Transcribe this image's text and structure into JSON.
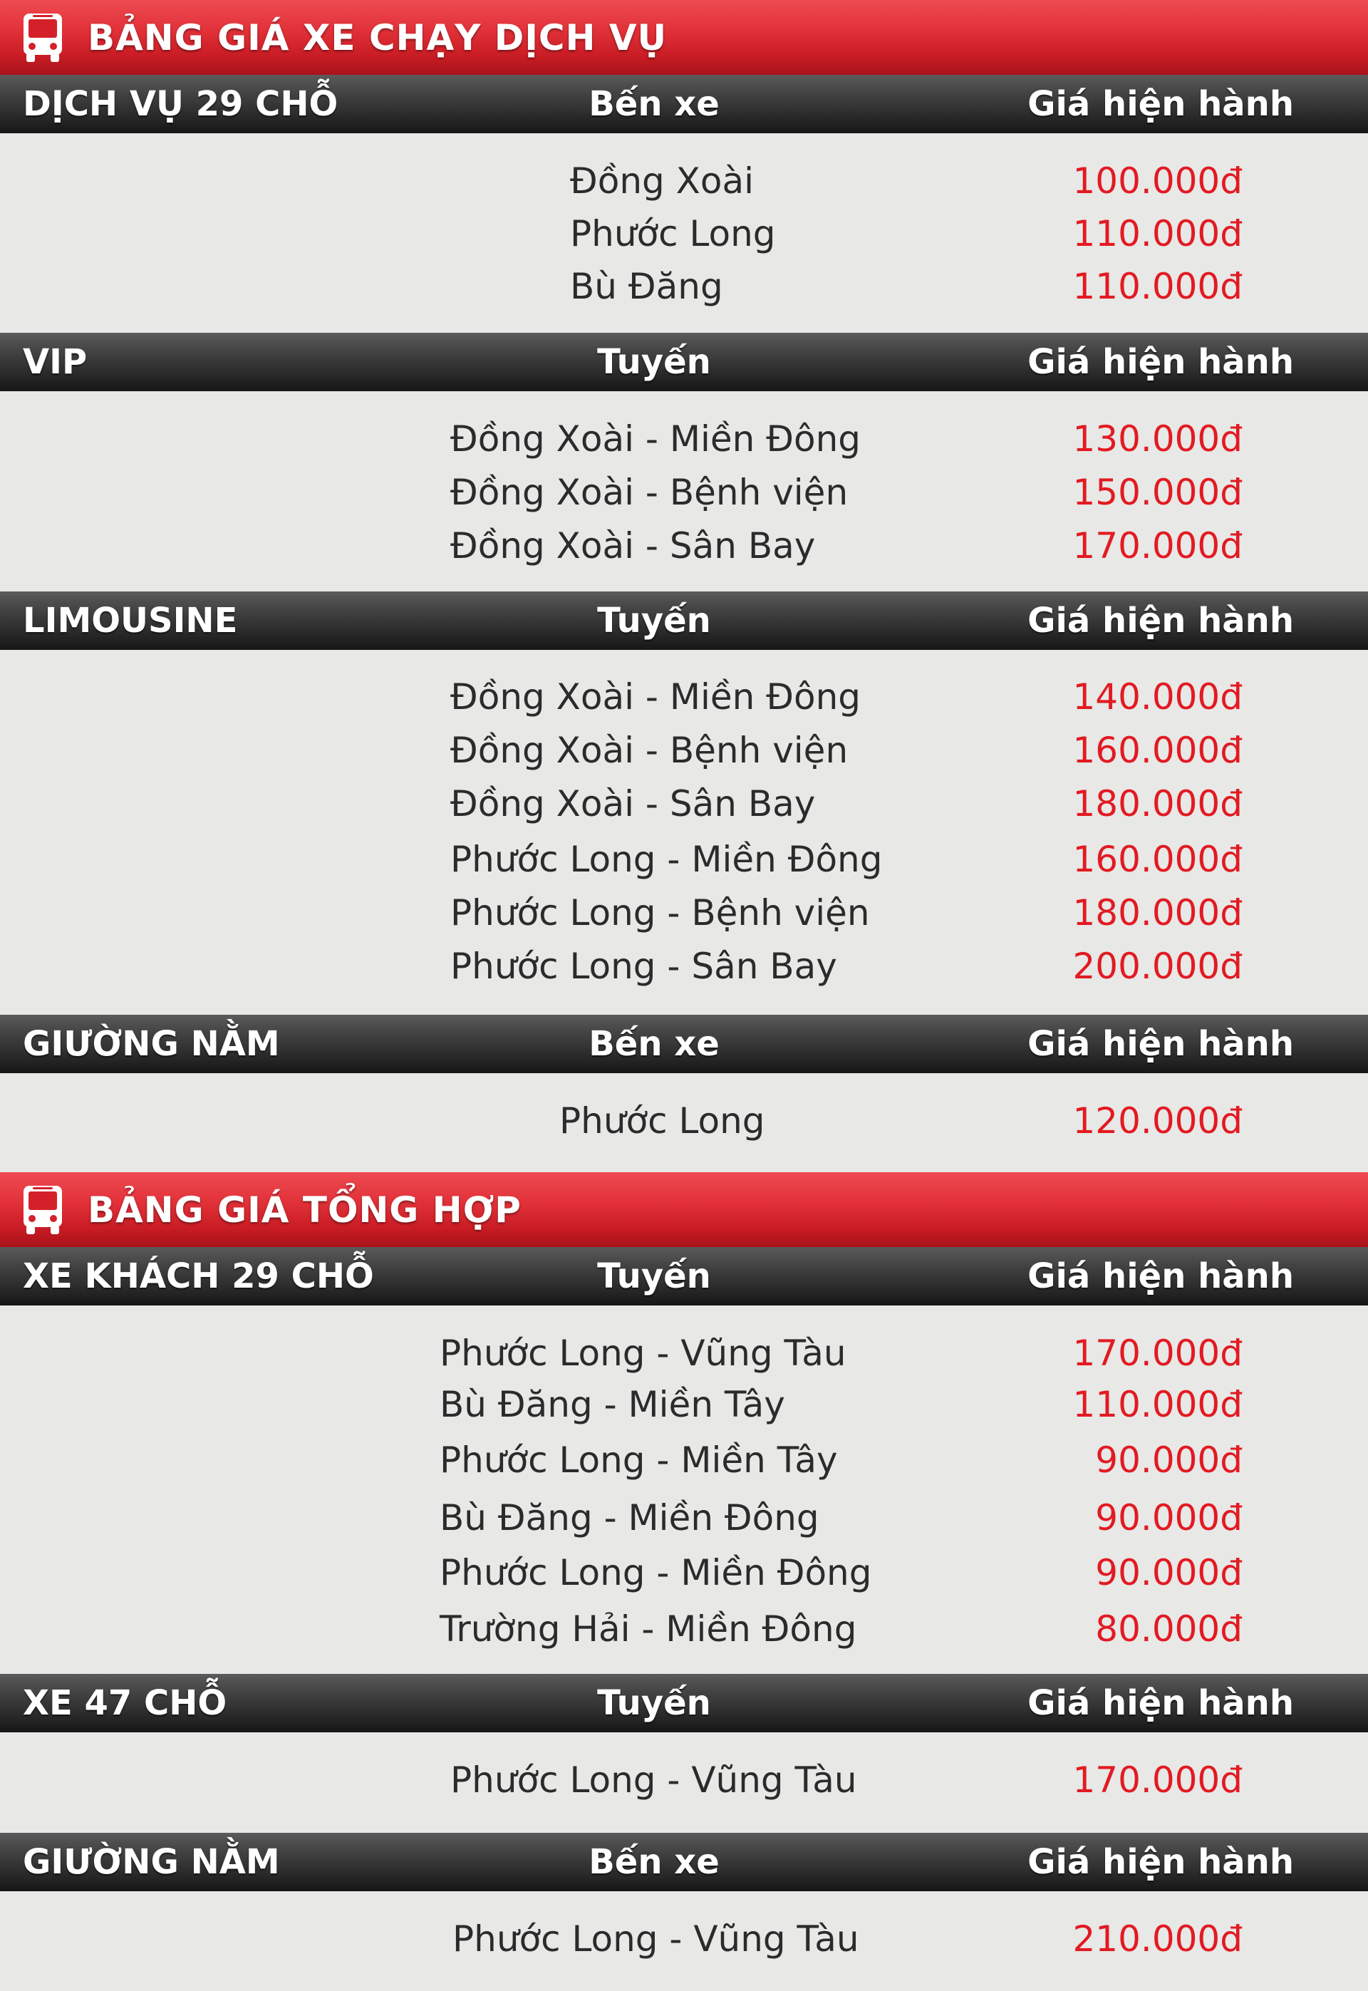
{
  "sections": [
    {
      "title": "BẢNG GIÁ XE CHẠY DỊCH VỤ",
      "icon": "bus-icon",
      "groups": [
        {
          "name": "DỊCH VỤ 29 CHỖ",
          "column_label": "Bến xe",
          "price_label": "Giá hiện hành",
          "rows": [
            {
              "route": "Đồng Xoài",
              "price": "100.000đ"
            },
            {
              "route": "Phước Long",
              "price": "110.000đ"
            },
            {
              "route": "Bù Đăng",
              "price": "110.000đ"
            }
          ]
        },
        {
          "name": "VIP",
          "column_label": "Tuyến",
          "price_label": "Giá hiện hành",
          "rows": [
            {
              "route": "Đồng Xoài - Miền Đông",
              "price": "130.000đ"
            },
            {
              "route": "Đồng Xoài - Bệnh viện",
              "price": "150.000đ"
            },
            {
              "route": "Đồng Xoài - Sân Bay",
              "price": "170.000đ"
            }
          ]
        },
        {
          "name": "LIMOUSINE",
          "column_label": "Tuyến",
          "price_label": "Giá hiện hành",
          "rows": [
            {
              "route": "Đồng Xoài - Miền Đông",
              "price": "140.000đ"
            },
            {
              "route": "Đồng Xoài - Bệnh viện",
              "price": "160.000đ"
            },
            {
              "route": "Đồng Xoài - Sân Bay",
              "price": "180.000đ"
            },
            {
              "route": "Phước Long - Miền Đông",
              "price": "160.000đ"
            },
            {
              "route": "Phước Long - Bệnh viện",
              "price": "180.000đ"
            },
            {
              "route": "Phước Long - Sân Bay",
              "price": "200.000đ"
            }
          ]
        },
        {
          "name": "GIƯỜNG NẰM",
          "column_label": "Bến xe",
          "price_label": "Giá hiện hành",
          "rows": [
            {
              "route": "Phước Long",
              "price": "120.000đ"
            }
          ]
        }
      ]
    },
    {
      "title": "BẢNG GIÁ TỔNG HỢP",
      "icon": "bus-icon",
      "groups": [
        {
          "name": "XE KHÁCH 29 CHỖ",
          "column_label": "Tuyến",
          "price_label": "Giá hiện hành",
          "rows": [
            {
              "route": "Phước Long - Vũng Tàu",
              "price": "170.000đ"
            },
            {
              "route": "Bù Đăng - Miền Tây",
              "price": "110.000đ"
            },
            {
              "route": "Phước Long - Miền Tây",
              "price": "90.000đ"
            },
            {
              "route": "Bù Đăng - Miền Đông",
              "price": "90.000đ"
            },
            {
              "route": "Phước Long - Miền Đông",
              "price": "90.000đ"
            },
            {
              "route": "Trường Hải - Miền Đông",
              "price": "80.000đ"
            }
          ]
        },
        {
          "name": "XE 47 CHỖ",
          "column_label": "Tuyến",
          "price_label": "Giá hiện hành",
          "rows": [
            {
              "route": "Phước Long - Vũng Tàu",
              "price": "170.000đ"
            }
          ]
        },
        {
          "name": "GIƯỜNG NẰM",
          "column_label": "Bến xe",
          "price_label": "Giá hiện hành",
          "rows": [
            {
              "route": "Phước Long - Vũng Tàu",
              "price": "210.000đ"
            }
          ]
        }
      ]
    }
  ]
}
